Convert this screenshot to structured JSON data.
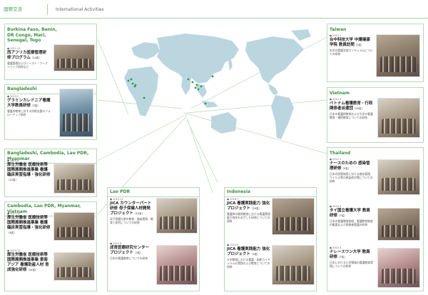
{
  "header": {
    "section_jp": "国際交流",
    "section_en": "International Activities"
  },
  "colors": {
    "accent": "#3c8f44",
    "border": "#b8d8ba",
    "map": "#bcd6e0",
    "marker": "#2e9a4a"
  },
  "left": [
    {
      "region": "Burkina Faso, Benin, DR Congo, Mari, Senegal, Togo",
      "entries": [
        {
          "date": "● 2011.12",
          "title": "西アフリカ医療管理研修プログラム",
          "title_note": "（14名）",
          "desc": "看護管理およびニーズイ・ワークショップ研修など"
        }
      ]
    },
    {
      "region": "Bangladeshi",
      "entries": [
        {
          "date": "● 2012.2",
          "title": "グラミンカレドニア看護大学教員研修",
          "title_note": "（3名）",
          "desc": "看護学教育に対する技術支援のフォローアップ研修"
        }
      ]
    },
    {
      "region": "Bangladeshi, Cambodia, Lao PDR, Myanmar",
      "entries": [
        {
          "date": "● 2016.9",
          "title": "厚生労働省 医療技術等 国際展開推進事業 看護臨床実習指導・強化研修",
          "title_note": "（12名）",
          "desc": ""
        }
      ]
    },
    {
      "region": "Cambodia, Lao PDR, Myanmar, Vietnam",
      "entries": [
        {
          "date": "● 2017.10",
          "title": "厚生労働省 医療技術等 国際展開推進事業 看護臨床実習指導・強化研修",
          "title_note": "（8名）",
          "desc": ""
        },
        {
          "date": "● 2015.12",
          "title": "厚生労働省 医療技術等 国際展開推進事業 東南アジア 看護助産人材 育成強化研修",
          "title_note": "（14名）",
          "desc": ""
        }
      ]
    }
  ],
  "lao": {
    "region": "Lao PDR",
    "entries": [
      {
        "date": "● 2015.11",
        "title": "JICA カウンターパート研修 母子保健人材開発プロジェクト",
        "title_note": "（10名）",
        "desc": "母子保健分野の教育・臨床実践・教育と研究についての研修"
      },
      {
        "date": "● 2012.8",
        "title": "成育医療研究センター プロジェクト",
        "title_note": "（3名）",
        "desc": "日本の看護教育についての研修"
      }
    ]
  },
  "indonesia": {
    "region": "Indonesia",
    "entries": [
      {
        "date": "● 2016.7",
        "title": "JICA 看護実践能力 強化プロジェクト",
        "title_note": "（20名）",
        "desc": "看護師の継続教育における看護実践能力強化をめざした研修についての研修"
      },
      {
        "date": "● 2014.9",
        "title": "JICA 看護実践能力 強化プロジェクト",
        "title_note": "（9名）",
        "desc": "大学教育における看護・助産カリキュラムの実践および教育についての研修"
      }
    ]
  },
  "right": [
    {
      "region": "Taiwan",
      "entries": [
        {
          "date": "● 2015.1",
          "title": "台中科技大学 中護健康学院 教員訪問",
          "title_note": "（3名）",
          "desc": "本学の看護学部カリキュラムについての研修"
        }
      ]
    },
    {
      "region": "Vietnam",
      "entries": [
        {
          "date": "● 2012.3",
          "title": "ベトナム看護教育・行政関係者派遣団",
          "title_note": "（20名）",
          "desc": "日本の看護師教育および大学の看護教育・継続教育についての研修"
        }
      ]
    },
    {
      "region": "Thailand",
      "entries": [
        {
          "date": "● 2012.7",
          "title": "ナースのための 感染管理研修",
          "title_note": "（5名）",
          "desc": "日本の医療施設における感染管理、ウイルス等の感染症対策についての研修"
        },
        {
          "date": "● 2015.4",
          "title": "タイ国立看護大学 教員研修",
          "title_note": "（7名）",
          "desc": "日本の看護教育制度、看護教育制度の概要および高齢者看護の研修"
        },
        {
          "date": "● 2015.3",
          "title": "ナレースワン大学 教員研修",
          "title_note": "（7名）",
          "desc": "日本における小児領域の看護教育環境についての研修"
        }
      ]
    }
  ]
}
